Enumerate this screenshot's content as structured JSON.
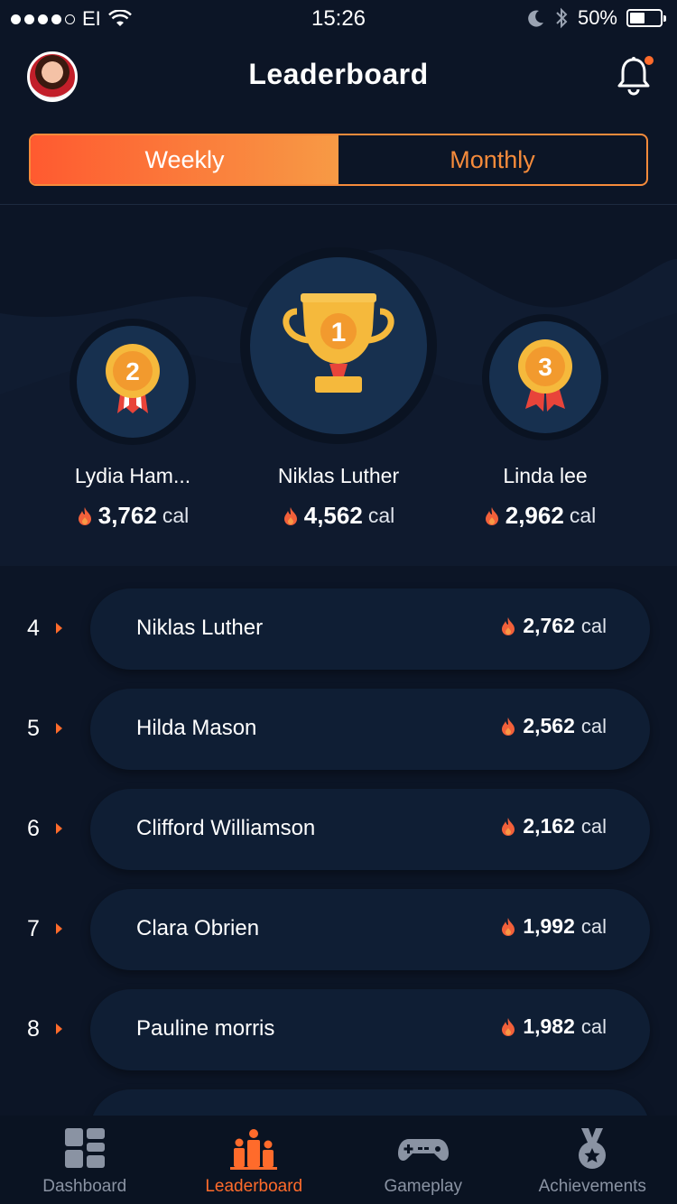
{
  "status_bar": {
    "carrier": "EI",
    "time": "15:26",
    "battery": "50%",
    "battery_level": 0.5
  },
  "header": {
    "title": "Leaderboard",
    "avatar_icon": "user-avatar",
    "notification_icon": "bell-icon",
    "has_notification": true
  },
  "toggle": {
    "weekly_label": "Weekly",
    "monthly_label": "Monthly",
    "selected": "Weekly"
  },
  "podium": {
    "first": {
      "rank": "1",
      "name": "Niklas Luther",
      "score": "4,562",
      "unit": "cal"
    },
    "second": {
      "rank": "2",
      "name": "Lydia Ham...",
      "score": "3,762",
      "unit": "cal"
    },
    "third": {
      "rank": "3",
      "name": "Linda lee",
      "score": "2,962",
      "unit": "cal"
    }
  },
  "rankings": [
    {
      "rank": "4",
      "name": "Niklas Luther",
      "score": "2,762",
      "unit": "cal"
    },
    {
      "rank": "5",
      "name": "Hilda Mason",
      "score": "2,562",
      "unit": "cal"
    },
    {
      "rank": "6",
      "name": "Clifford Williamson",
      "score": "2,162",
      "unit": "cal"
    },
    {
      "rank": "7",
      "name": "Clara Obrien",
      "score": "1,992",
      "unit": "cal"
    },
    {
      "rank": "8",
      "name": "Pauline morris",
      "score": "1,982",
      "unit": "cal"
    }
  ],
  "tabs": [
    {
      "label": "Dashboard",
      "icon": "dashboard-icon"
    },
    {
      "label": "Leaderboard",
      "icon": "leaderboard-icon",
      "active": true
    },
    {
      "label": "Gameplay",
      "icon": "gamepad-icon"
    },
    {
      "label": "Achievements",
      "icon": "medal-icon"
    }
  ],
  "colors": {
    "background": "#0c1526",
    "card": "#0f1e34",
    "accent": "#ff6b2b",
    "accent_gradient_end": "#f79a45",
    "gold": "#f5b93c"
  }
}
